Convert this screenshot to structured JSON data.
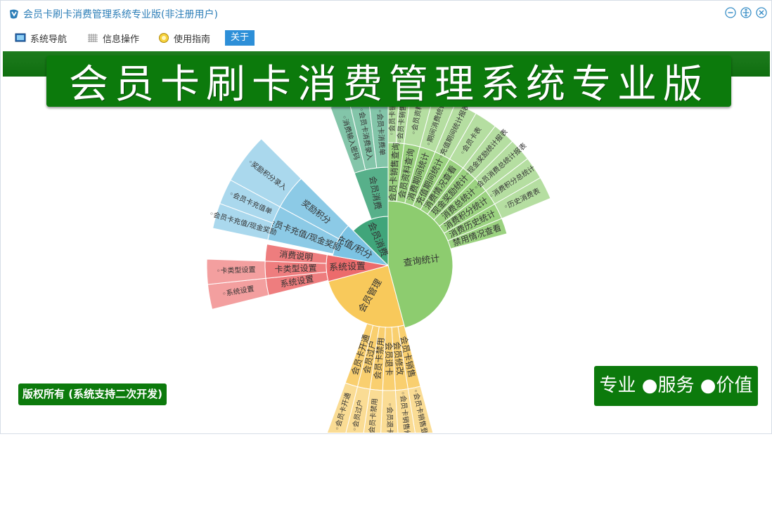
{
  "window": {
    "title": "会员卡刷卡消费管理系统专业版(非注册用户)",
    "accent": "#2e7fb8"
  },
  "menubar": {
    "items": [
      {
        "label": "系统导航",
        "icon": "monitor-icon"
      },
      {
        "label": "信息操作",
        "icon": "grid-icon"
      },
      {
        "label": "使用指南",
        "icon": "bulb-icon"
      },
      {
        "label": "关于",
        "icon": ""
      }
    ]
  },
  "banner": {
    "title": "会员卡刷卡消费管理系统专业版",
    "color": "#0c7a0c"
  },
  "copyright": "版权所有 (系统支持二次开发)",
  "slogan": "专业 ●服务 ●价值",
  "sunburst": {
    "center_label": "",
    "colors": {
      "查询统计": "#8dcc6f",
      "会员管理": "#f8c95b",
      "系统设置": "#ec6b6c",
      "充值/积分": "#7cc3e3",
      "会员消费": "#40a57a"
    },
    "categories": [
      {
        "name": "查询统计",
        "items": [
          {
            "name": "会员卡销售查询",
            "leaves": [
              "会员卡销售",
              "会员卡销售统计"
            ]
          },
          {
            "name": "会员资料查询",
            "leaves": [
              "会员资料"
            ]
          },
          {
            "name": "消费期间统计",
            "leaves": [
              "期间消费统计"
            ]
          },
          {
            "name": "充值期间统计",
            "leaves": [
              "充值期间统计报表"
            ]
          },
          {
            "name": "消费情况查看",
            "leaves": [
              "会员卡表"
            ]
          },
          {
            "name": "现金奖励统计",
            "leaves": [
              "现金奖励统计报表"
            ]
          },
          {
            "name": "消费总统计",
            "leaves": [
              "会员消费总统计报表"
            ]
          },
          {
            "name": "消费积分统计",
            "leaves": [
              "消费积分总统计"
            ]
          },
          {
            "name": "消费历史统计",
            "leaves": [
              "历史消费表"
            ]
          },
          {
            "name": "禁用情况查看",
            "leaves": []
          }
        ]
      },
      {
        "name": "会员管理",
        "items": [
          {
            "name": "会员卡销售",
            "leaves": [
              "会员卡销售登记"
            ]
          },
          {
            "name": "会员修改",
            "leaves": [
              "会员卡销售修改"
            ]
          },
          {
            "name": "会员退卡",
            "leaves": [
              "会员退卡"
            ]
          },
          {
            "name": "会员卡禁用",
            "leaves": [
              "会员卡禁用"
            ]
          },
          {
            "name": "会员过户",
            "leaves": [
              "会员过户"
            ]
          },
          {
            "name": "会员卡开通",
            "leaves": [
              "会员卡开通"
            ]
          }
        ]
      },
      {
        "name": "系统设置",
        "items": [
          {
            "name": "系统设置",
            "leaves": [
              "系统设置"
            ]
          },
          {
            "name": "卡类型设置",
            "leaves": [
              "卡类型设置"
            ]
          },
          {
            "name": "消费说明",
            "leaves": []
          }
        ]
      },
      {
        "name": "充值/积分",
        "items": [
          {
            "name": "会员卡充值/现金奖励",
            "leaves": [
              "会员卡充值/现金奖励",
              "会员卡充值单"
            ]
          },
          {
            "name": "奖励积分",
            "leaves": [
              "奖励积分录入"
            ]
          }
        ]
      },
      {
        "name": "会员消费",
        "items": [
          {
            "name": "会员消费",
            "leaves": [
              "消费输入密码",
              "会员卡消费录入",
              "会员卡消费单"
            ]
          }
        ]
      }
    ]
  }
}
